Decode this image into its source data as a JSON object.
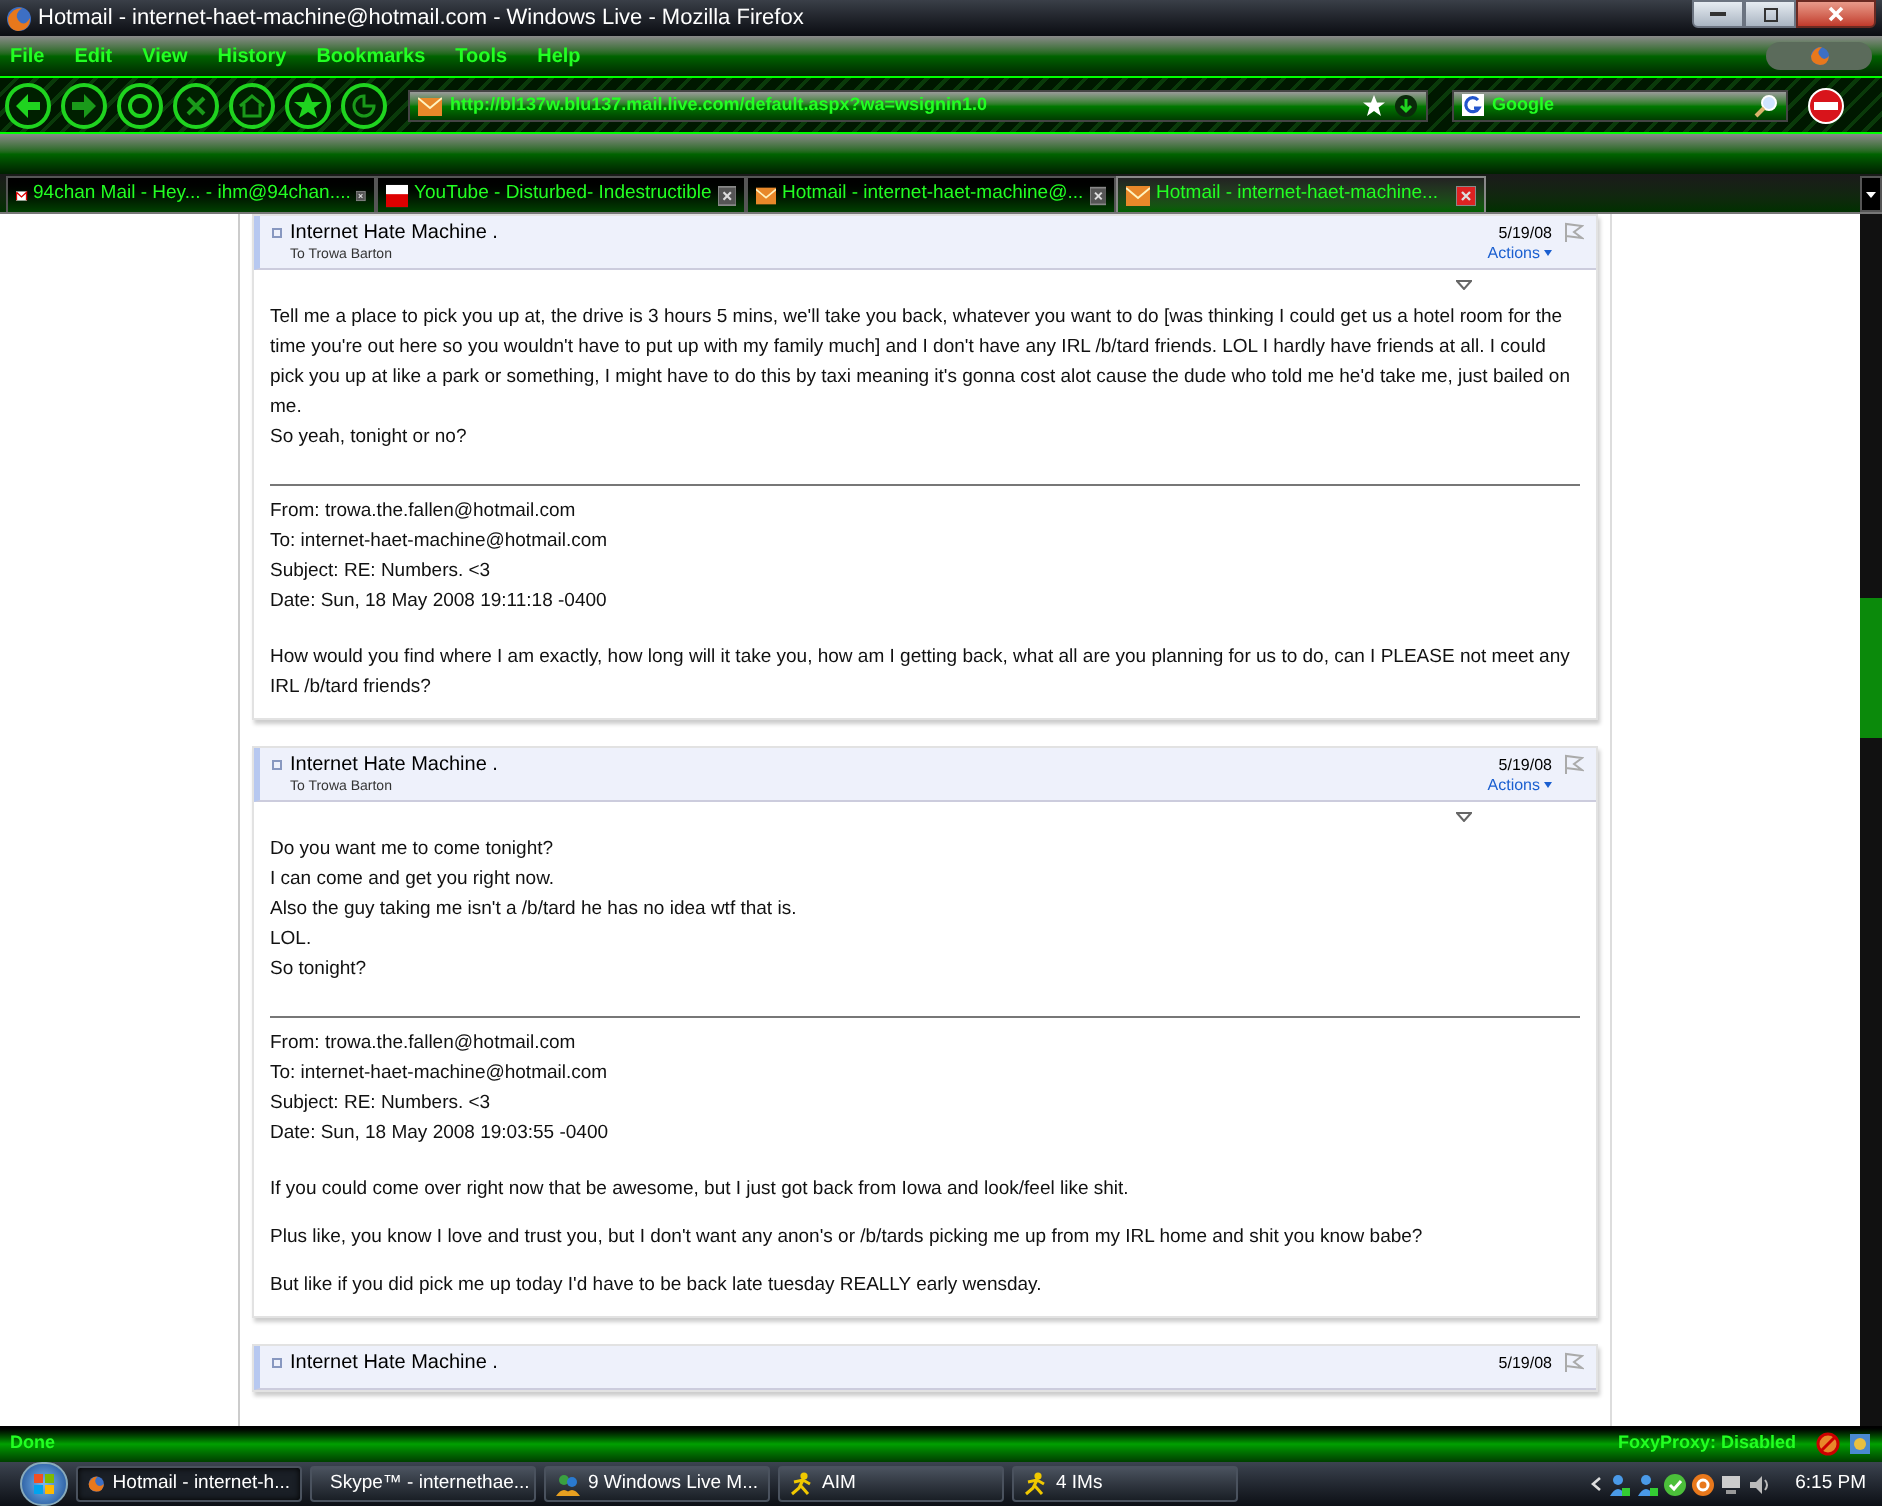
{
  "window": {
    "title": "Hotmail - internet-haet-machine@hotmail.com - Windows Live - Mozilla Firefox"
  },
  "menu": [
    "File",
    "Edit",
    "View",
    "History",
    "Bookmarks",
    "Tools",
    "Help"
  ],
  "address_bar": {
    "url": "http://bl137w.blu137.mail.live.com/default.aspx?wa=wsignin1.0"
  },
  "search": {
    "placeholder": "Google"
  },
  "tabs": [
    {
      "label": "94chan Mail - Hey... - ihm@94chan....",
      "kind": "mail",
      "selected": false
    },
    {
      "label": "YouTube - Disturbed- Indestructible",
      "kind": "video",
      "selected": false
    },
    {
      "label": "Hotmail - internet-haet-machine@...",
      "kind": "hotmail",
      "selected": false
    },
    {
      "label": "Hotmail - internet-haet-machine...",
      "kind": "hotmail",
      "selected": true
    }
  ],
  "messages": [
    {
      "sender": "Internet Hate Machine .",
      "to": "To Trowa Barton",
      "date": "5/19/08",
      "actions": "Actions",
      "body": [
        "Tell me a place to pick you up at, the drive is 3 hours 5 mins, we'll take you back, whatever you want to do [was thinking I could get us a hotel room for the time you're out here so you wouldn't have to put up with my family much] and I don't have any IRL /b/tard friends. LOL I hardly have friends at all. I could pick you up at like a park or something, I might have to do this by taxi meaning it's gonna cost alot cause the dude who told me he'd take me, just bailed on me.",
        "So yeah, tonight or no?"
      ],
      "quote": [
        "From: trowa.the.fallen@hotmail.com",
        "To: internet-haet-machine@hotmail.com",
        "Subject: RE: Numbers. <3",
        "Date: Sun, 18 May 2008 19:11:18 -0400"
      ],
      "quote_body": [
        "How would you find where I am exactly, how long will it take you, how am I getting back, what all are you planning for us to do, can I PLEASE not meet any IRL /b/tard friends?"
      ]
    },
    {
      "sender": "Internet Hate Machine .",
      "to": "To Trowa Barton",
      "date": "5/19/08",
      "actions": "Actions",
      "body": [
        "Do you want me to come tonight?",
        "I can come and get you right now.",
        "Also the guy taking me isn't a /b/tard he has no idea wtf that is.",
        "LOL.",
        "So tonight?"
      ],
      "quote": [
        "From: trowa.the.fallen@hotmail.com",
        "To: internet-haet-machine@hotmail.com",
        "Subject: RE: Numbers. <3",
        "Date: Sun, 18 May 2008 19:03:55 -0400"
      ],
      "quote_body": [
        "If you could come over right now that be awesome, but I just got back from Iowa and look/feel like shit.",
        "Plus like, you know I love and trust you, but I don't want any anon's or /b/tards picking me up from my IRL home and shit you know babe?",
        "But like if you did pick me up today I'd have to be back late tuesday REALLY early wensday."
      ]
    },
    {
      "sender": "Internet Hate Machine .",
      "date": "5/19/08"
    }
  ],
  "status_bar": {
    "text": "Done",
    "proxy": "FoxyProxy: Disabled"
  },
  "taskbar": {
    "items": [
      {
        "label": "Hotmail - internet-h...",
        "kind": "firefox",
        "selected": true
      },
      {
        "label": "Skype™ - internethae...",
        "kind": "skype",
        "selected": false
      },
      {
        "label": "9 Windows Live M...",
        "kind": "messenger",
        "selected": false
      },
      {
        "label": "AIM",
        "kind": "aim",
        "selected": false
      },
      {
        "label": "4 IMs",
        "kind": "aim",
        "selected": false
      }
    ],
    "time": "6:15 PM"
  }
}
